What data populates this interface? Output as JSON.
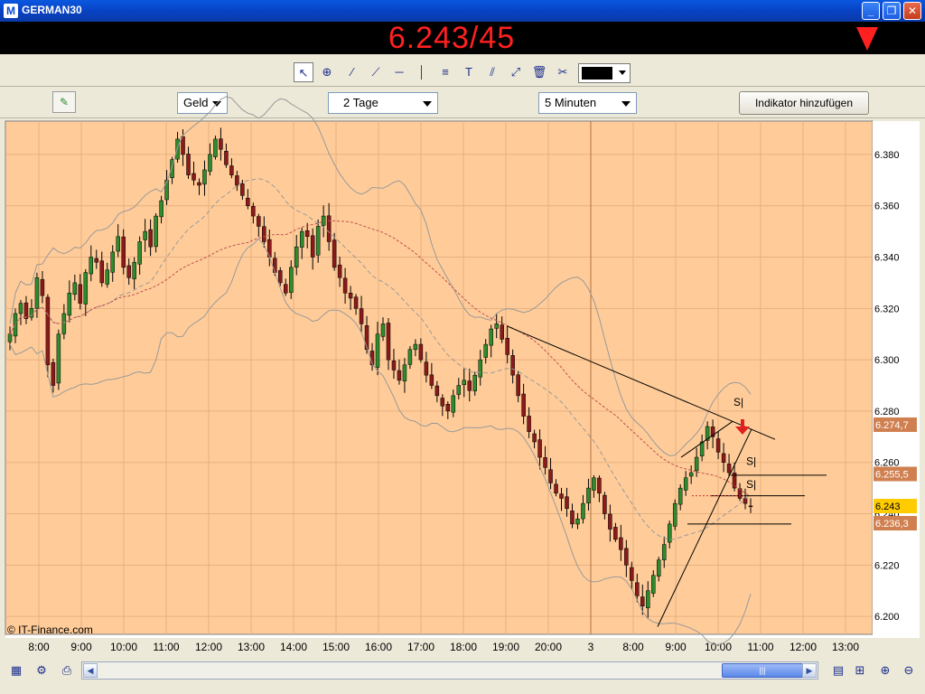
{
  "window": {
    "title": "GERMAN30",
    "app_icon": "M",
    "minimize": "_",
    "restore": "❐",
    "close": "✕"
  },
  "banner": {
    "price": "6.243/45",
    "direction_icon": "down-arrow-icon",
    "color": "#ff2020"
  },
  "toolbar1": {
    "tools": [
      "pointer-icon",
      "zoom-icon",
      "line-icon",
      "ray-icon",
      "horizontal-line-icon",
      "vertical-line-icon",
      "fibonacci-icon",
      "text-icon",
      "parallel-lines-icon",
      "channel-icon",
      "trash-icon",
      "tools-icon"
    ],
    "color_value": "#000000"
  },
  "toolbar2": {
    "icon": "chart-settings-icon",
    "price_type": "Geld",
    "period": "2 Tage",
    "interval": "5 Minuten",
    "add_indicator": "Indikator hinzufügen"
  },
  "chart_data": {
    "type": "candlestick",
    "title": "",
    "background": "#ffcc99",
    "y_ticks": [
      "6.380",
      "6.360",
      "6.340",
      "6.320",
      "6.300",
      "6.280",
      "6.260",
      "6.240",
      "6.220",
      "6.200"
    ],
    "y_range": [
      6193,
      6393
    ],
    "x_ticks": [
      "8:00",
      "9:00",
      "10:00",
      "11:00",
      "12:00",
      "13:00",
      "14:00",
      "15:00",
      "16:00",
      "17:00",
      "18:00",
      "19:00",
      "20:00",
      "3",
      "8:00",
      "9:00",
      "10:00",
      "11:00",
      "12:00",
      "13:00"
    ],
    "price_labels": [
      {
        "value": "6.274,7",
        "y": 6274.7,
        "color": "#d08050"
      },
      {
        "value": "6.255,5",
        "y": 6255.5,
        "color": "#d08050"
      },
      {
        "value": "6.243",
        "y": 6243,
        "color": "#ffcc00"
      },
      {
        "value": "6.236,3",
        "y": 6236.3,
        "color": "#d08050"
      }
    ],
    "last_price_suffix": "1",
    "annotations": [
      "S|",
      "S|",
      "S|"
    ],
    "copyright": "© IT-Finance.com",
    "closes": [
      6310,
      6318,
      6322,
      6316,
      6320,
      6332,
      6325,
      6298,
      6290,
      6310,
      6318,
      6326,
      6330,
      6322,
      6334,
      6340,
      6338,
      6330,
      6335,
      6342,
      6348,
      6336,
      6332,
      6338,
      6346,
      6350,
      6344,
      6356,
      6362,
      6370,
      6378,
      6386,
      6380,
      6372,
      6370,
      6368,
      6374,
      6380,
      6386,
      6382,
      6376,
      6372,
      6368,
      6364,
      6360,
      6356,
      6352,
      6346,
      6340,
      6334,
      6330,
      6326,
      6336,
      6344,
      6350,
      6348,
      6340,
      6352,
      6356,
      6346,
      6336,
      6332,
      6326,
      6324,
      6320,
      6314,
      6304,
      6298,
      6310,
      6314,
      6300,
      6296,
      6292,
      6298,
      6304,
      6306,
      6300,
      6294,
      6290,
      6286,
      6282,
      6280,
      6286,
      6290,
      6292,
      6288,
      6294,
      6300,
      6306,
      6312,
      6314,
      6308,
      6302,
      6294,
      6286,
      6278,
      6272,
      6268,
      6262,
      6258,
      6252,
      6248,
      6246,
      6242,
      6236,
      6238,
      6244,
      6250,
      6254,
      6248,
      6240,
      6234,
      6230,
      6226,
      6220,
      6214,
      6208,
      6204,
      6210,
      6216,
      6222,
      6228,
      6236,
      6244,
      6250,
      6254,
      6256,
      6262,
      6268,
      6274,
      6270,
      6264,
      6260,
      6256,
      6250,
      6246,
      6244,
      6243
    ]
  },
  "bottombar": {
    "left_icons": [
      "chart-add-icon",
      "settings-icon",
      "print-icon"
    ],
    "right_icons": [
      "chart-grid-icon",
      "zoom-fit-icon",
      "zoom-in-icon",
      "zoom-out-icon"
    ],
    "scroll_thumb": "|||"
  }
}
